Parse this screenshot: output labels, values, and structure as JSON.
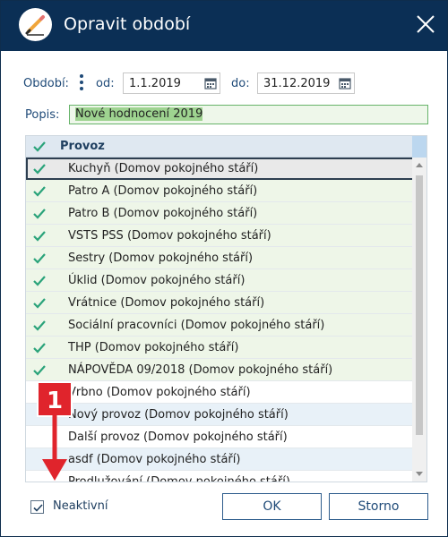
{
  "window": {
    "title": "Opravit období"
  },
  "period": {
    "label": "Období:",
    "from_label": "od:",
    "from_value": "1.1.2019",
    "to_label": "do:",
    "to_value": "31.12.2019"
  },
  "description": {
    "label": "Popis:",
    "value": "Nové hodnocení 2019"
  },
  "grid": {
    "column_header": "Provoz",
    "rows": [
      {
        "label": "Kuchyň (Domov pokojného stáří)",
        "checked": true
      },
      {
        "label": "Patro A (Domov pokojného stáří)",
        "checked": true
      },
      {
        "label": "Patro B (Domov pokojného stáří)",
        "checked": true
      },
      {
        "label": "VSTS PSS (Domov pokojného stáří)",
        "checked": true
      },
      {
        "label": "Sestry (Domov pokojného stáří)",
        "checked": true
      },
      {
        "label": "Úklid (Domov pokojného stáří)",
        "checked": true
      },
      {
        "label": "Vrátnice (Domov pokojného stáří)",
        "checked": true
      },
      {
        "label": "Sociální pracovníci (Domov pokojného stáří)",
        "checked": true
      },
      {
        "label": "THP (Domov pokojného stáří)",
        "checked": true
      },
      {
        "label": "NÁPOVĚDA 09/2018 (Domov pokojného stáří)",
        "checked": true
      },
      {
        "label": "Vrbno (Domov pokojného stáří)",
        "checked": false
      },
      {
        "label": "Nový provoz (Domov pokojného stáří)",
        "checked": false
      },
      {
        "label": "Další provoz (Domov pokojného stáří)",
        "checked": false
      },
      {
        "label": "asdf (Domov pokojného stáří)",
        "checked": false
      },
      {
        "label": "Prodlužování (Domov pokojného stáří)",
        "checked": false
      }
    ]
  },
  "annotation": {
    "badge": "1"
  },
  "footer": {
    "inactive_label": "Neaktivní",
    "inactive_checked": true,
    "ok_label": "OK",
    "cancel_label": "Storno"
  },
  "colors": {
    "titlebar": "#0b2f55",
    "check_green": "#2aa37a",
    "accent_text": "#1f4a78",
    "badge_red": "#e0242c"
  },
  "icons": {
    "app": "pencil-icon",
    "close": "close-icon",
    "calendar": "calendar-icon",
    "options": "kebab-menu-icon",
    "check": "check-icon",
    "arrow": "arrow-down-icon"
  }
}
